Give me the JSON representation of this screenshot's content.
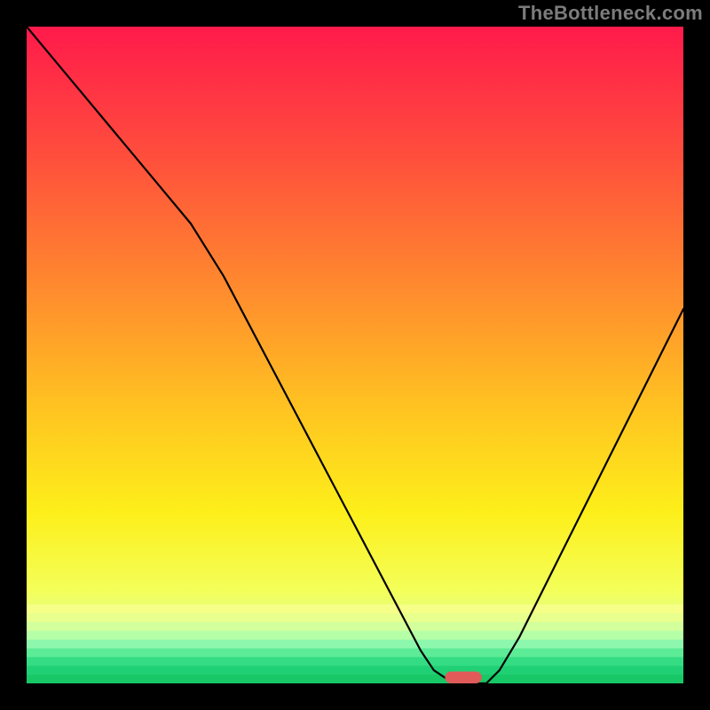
{
  "watermark": "TheBottleneck.com",
  "chart_data": {
    "type": "line",
    "xlabel": "",
    "ylabel": "",
    "xlim": [
      0,
      100
    ],
    "ylim": [
      0,
      100
    ],
    "background_gradient": [
      {
        "stop": 0.0,
        "color": "#ff1a4b"
      },
      {
        "stop": 0.2,
        "color": "#ff4f3c"
      },
      {
        "stop": 0.4,
        "color": "#ff8b2e"
      },
      {
        "stop": 0.58,
        "color": "#ffc321"
      },
      {
        "stop": 0.74,
        "color": "#fdef1a"
      },
      {
        "stop": 0.86,
        "color": "#f3ff5a"
      },
      {
        "stop": 0.93,
        "color": "#d8ffa0"
      },
      {
        "stop": 0.965,
        "color": "#8cf7b0"
      },
      {
        "stop": 0.985,
        "color": "#2be07a"
      },
      {
        "stop": 1.0,
        "color": "#18c765"
      }
    ],
    "series": [
      {
        "name": "bottleneck-curve",
        "color": "#000000",
        "width": 2.2,
        "x": [
          0,
          5,
          10,
          15,
          20,
          25,
          30,
          35,
          40,
          45,
          50,
          55,
          60,
          62,
          65,
          68,
          70,
          72,
          75,
          80,
          85,
          90,
          95,
          100
        ],
        "y": [
          100,
          94,
          88,
          82,
          76,
          70,
          62,
          52.5,
          43,
          33.5,
          24,
          14.5,
          5,
          2,
          0,
          0,
          0,
          2,
          7,
          17,
          27,
          37,
          47,
          57
        ]
      }
    ],
    "marker": {
      "name": "optimal-marker",
      "color": "#e05a5a",
      "x_center": 66.5,
      "x_halfwidth": 2.8,
      "y": 0,
      "height_frac": 0.018
    }
  }
}
